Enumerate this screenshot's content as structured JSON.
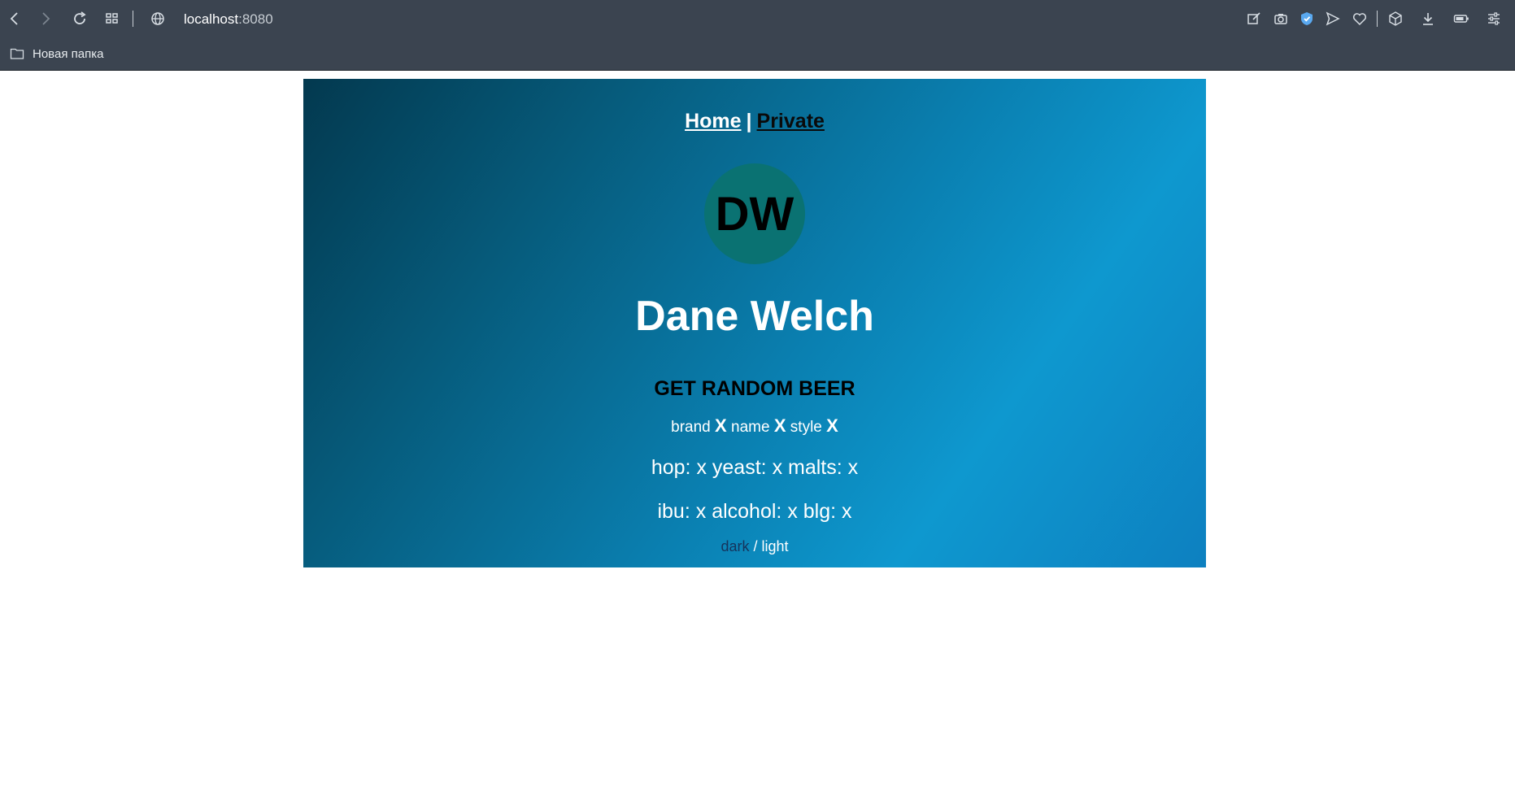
{
  "browser": {
    "address_host": "localhost",
    "address_port": ":8080",
    "bookmark_folder": "Новая папка"
  },
  "nav": {
    "home": "Home",
    "separator": "|",
    "private": "Private"
  },
  "profile": {
    "initials": "DW",
    "name": "Dane Welch"
  },
  "beer": {
    "button_label": "GET RANDOM BEER",
    "brand_label": "brand",
    "brand_value": "X",
    "name_label": "name",
    "name_value": "X",
    "style_label": "style",
    "style_value": "X",
    "hop_label": "hop:",
    "hop_value": "x",
    "yeast_label": "yeast:",
    "yeast_value": "x",
    "malts_label": "malts:",
    "malts_value": "x",
    "ibu_label": "ibu:",
    "ibu_value": "x",
    "alcohol_label": "alcohol:",
    "alcohol_value": "x",
    "blg_label": "blg:",
    "blg_value": "x"
  },
  "theme": {
    "dark": "dark",
    "slash": "/",
    "light": "light"
  },
  "colors": {
    "chrome_bg": "#3b4450",
    "avatar_bg": "#0a7272",
    "gradient_start": "#03394f",
    "gradient_end": "#0e98cf",
    "dark_link": "#15345c"
  }
}
